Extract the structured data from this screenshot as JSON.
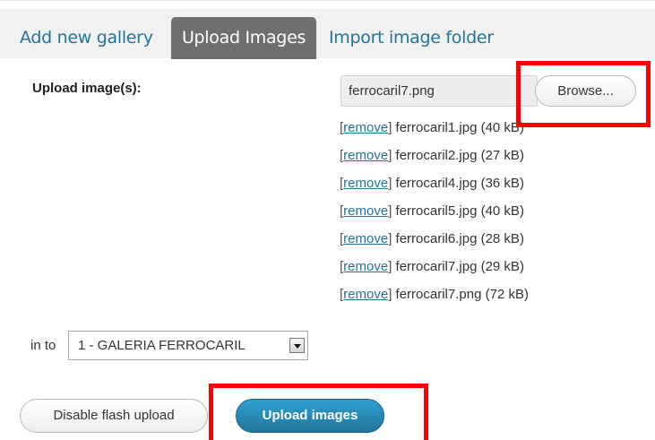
{
  "tabs": [
    {
      "label": "Add new gallery"
    },
    {
      "label": "Upload Images"
    },
    {
      "label": "Import image folder"
    }
  ],
  "upload": {
    "label": "Upload image(s):",
    "selected_file": "ferrocaril7.png",
    "browse_label": "Browse..."
  },
  "files": [
    {
      "remove": "remove",
      "name": "ferrocaril1.jpg (40 kB)"
    },
    {
      "remove": "remove",
      "name": "ferrocaril2.jpg (27 kB)"
    },
    {
      "remove": "remove",
      "name": "ferrocaril4.jpg (36 kB)"
    },
    {
      "remove": "remove",
      "name": "ferrocaril5.jpg (40 kB)"
    },
    {
      "remove": "remove",
      "name": "ferrocaril6.jpg (28 kB)"
    },
    {
      "remove": "remove",
      "name": "ferrocaril7.jpg (29 kB)"
    },
    {
      "remove": "remove",
      "name": "ferrocaril7.png (72 kB)"
    }
  ],
  "into": {
    "label": "in to",
    "selected_gallery": "1 - GALERIA FERROCARIL"
  },
  "buttons": {
    "disable_flash": "Disable flash upload",
    "upload_images": "Upload images"
  },
  "colors": {
    "accent": "#21759b",
    "active_tab": "#6f6f6f",
    "highlight": "#ff0000"
  }
}
